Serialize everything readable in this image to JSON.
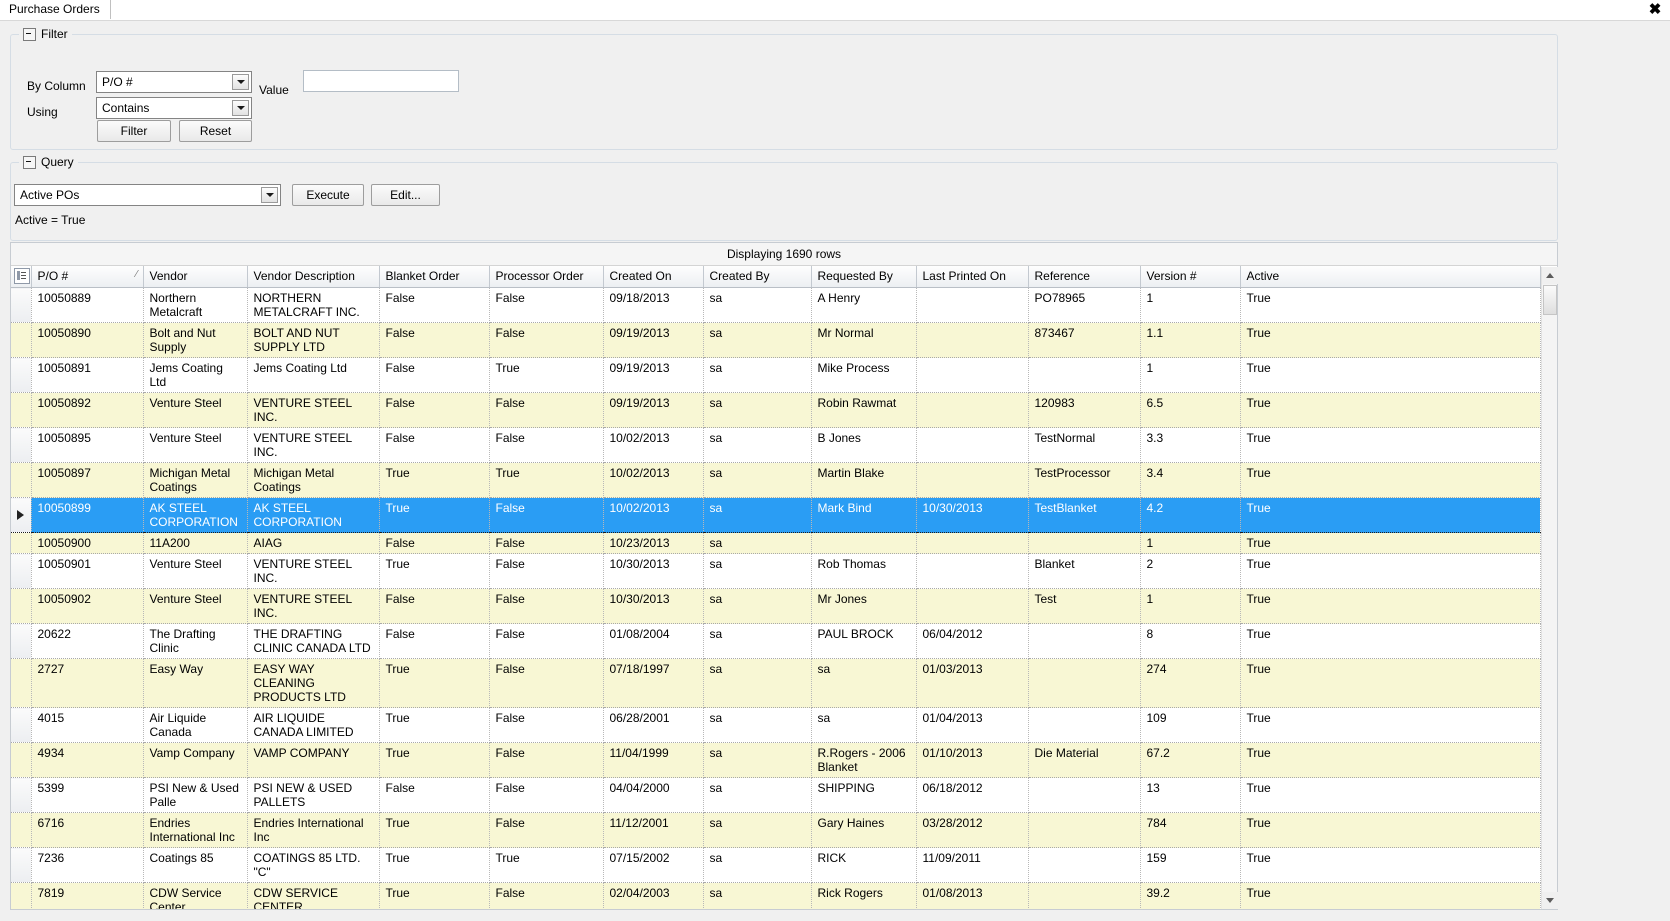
{
  "window": {
    "tab_label": "Purchase Orders",
    "close_icon": "close-icon"
  },
  "filter": {
    "caption": "Filter",
    "by_column_label": "By Column",
    "by_column_value": "P/O #",
    "value_label": "Value",
    "value_text": "",
    "value_placeholder": "",
    "using_label": "Using",
    "using_value": "Contains",
    "filter_button": "Filter",
    "reset_button": "Reset"
  },
  "query": {
    "caption": "Query",
    "selected": "Active POs",
    "execute_button": "Execute",
    "edit_button": "Edit...",
    "description": "Active = True"
  },
  "grid": {
    "status": "Displaying 1690 rows",
    "sort_indicator": "⁄",
    "columns": [
      "P/O #",
      "Vendor",
      "Vendor Description",
      "Blanket Order",
      "Processor Order",
      "Created On",
      "Created By",
      "Requested By",
      "Last Printed On",
      "Reference",
      "Version #",
      "Active"
    ],
    "rows": [
      {
        "cells": [
          "10050889",
          "Northern Metalcraft",
          "NORTHERN METALCRAFT INC.",
          "False",
          "False",
          "09/18/2013",
          "sa",
          "A Henry",
          "",
          "PO78965",
          "1",
          "True"
        ],
        "selected": false
      },
      {
        "cells": [
          "10050890",
          "Bolt and Nut Supply",
          "BOLT AND NUT SUPPLY LTD",
          "False",
          "False",
          "09/19/2013",
          "sa",
          "Mr Normal",
          "",
          "873467",
          "1.1",
          "True"
        ],
        "selected": false
      },
      {
        "cells": [
          "10050891",
          "Jems Coating Ltd",
          "Jems Coating Ltd",
          "False",
          "True",
          "09/19/2013",
          "sa",
          "Mike Process",
          "",
          "",
          "1",
          "True"
        ],
        "selected": false
      },
      {
        "cells": [
          "10050892",
          "Venture Steel",
          "VENTURE STEEL INC.",
          "False",
          "False",
          "09/19/2013",
          "sa",
          "Robin Rawmat",
          "",
          "120983",
          "6.5",
          "True"
        ],
        "selected": false
      },
      {
        "cells": [
          "10050895",
          "Venture Steel",
          "VENTURE STEEL INC.",
          "False",
          "False",
          "10/02/2013",
          "sa",
          "B Jones",
          "",
          "TestNormal",
          "3.3",
          "True"
        ],
        "selected": false
      },
      {
        "cells": [
          "10050897",
          "Michigan Metal Coatings",
          "Michigan Metal Coatings",
          "True",
          "True",
          "10/02/2013",
          "sa",
          "Martin Blake",
          "",
          "TestProcessor",
          "3.4",
          "True"
        ],
        "selected": false
      },
      {
        "cells": [
          "10050899",
          "AK STEEL CORPORATION",
          "AK STEEL CORPORATION",
          "True",
          "False",
          "10/02/2013",
          "sa",
          "Mark Bind",
          "10/30/2013",
          "TestBlanket",
          "4.2",
          "True"
        ],
        "selected": true
      },
      {
        "cells": [
          "10050900",
          "11A200",
          "AIAG",
          "False",
          "False",
          "10/23/2013",
          "sa",
          "",
          "",
          "",
          "1",
          "True"
        ],
        "selected": false
      },
      {
        "cells": [
          "10050901",
          "Venture Steel",
          "VENTURE STEEL INC.",
          "True",
          "False",
          "10/30/2013",
          "sa",
          "Rob Thomas",
          "",
          "Blanket",
          "2",
          "True"
        ],
        "selected": false
      },
      {
        "cells": [
          "10050902",
          "Venture Steel",
          "VENTURE STEEL INC.",
          "False",
          "False",
          "10/30/2013",
          "sa",
          "Mr Jones",
          "",
          "Test",
          "1",
          "True"
        ],
        "selected": false
      },
      {
        "cells": [
          "20622",
          "The Drafting Clinic",
          "THE DRAFTING CLINIC CANADA LTD",
          "False",
          "False",
          "01/08/2004",
          "sa",
          "PAUL BROCK",
          "06/04/2012",
          "",
          "8",
          "True"
        ],
        "selected": false
      },
      {
        "cells": [
          "2727",
          "Easy Way",
          "EASY WAY CLEANING PRODUCTS LTD",
          "True",
          "False",
          "07/18/1997",
          "sa",
          "sa",
          "01/03/2013",
          "",
          "274",
          "True"
        ],
        "selected": false
      },
      {
        "cells": [
          "4015",
          "Air Liquide Canada",
          "AIR LIQUIDE CANADA LIMITED",
          "True",
          "False",
          "06/28/2001",
          "sa",
          "sa",
          "01/04/2013",
          "",
          "109",
          "True"
        ],
        "selected": false
      },
      {
        "cells": [
          "4934",
          "Vamp Company",
          "VAMP COMPANY",
          "True",
          "False",
          "11/04/1999",
          "sa",
          "R.Rogers -  2006 Blanket",
          "01/10/2013",
          "Die Material",
          "67.2",
          "True"
        ],
        "selected": false
      },
      {
        "cells": [
          "5399",
          "PSI New & Used Palle",
          "PSI NEW & USED PALLETS",
          "False",
          "False",
          "04/04/2000",
          "sa",
          "SHIPPING",
          "06/18/2012",
          "",
          "13",
          "True"
        ],
        "selected": false
      },
      {
        "cells": [
          "6716",
          "Endries International Inc",
          "Endries International Inc",
          "True",
          "False",
          "11/12/2001",
          "sa",
          "Gary Haines",
          "03/28/2012",
          "",
          "784",
          "True"
        ],
        "selected": false
      },
      {
        "cells": [
          "7236",
          "Coatings 85",
          "COATINGS 85 LTD. \"C\"",
          "True",
          "True",
          "07/15/2002",
          "sa",
          "RICK",
          "11/09/2011",
          "",
          "159",
          "True"
        ],
        "selected": false
      },
      {
        "cells": [
          "7819",
          "CDW Service Center",
          "CDW SERVICE CENTER",
          "True",
          "False",
          "02/04/2003",
          "sa",
          "Rick Rogers",
          "01/08/2013",
          "",
          "39.2",
          "True"
        ],
        "selected": false
      }
    ]
  },
  "colors": {
    "selection": "#2a9df4",
    "alt_row": "#f8f7d4",
    "panel": "#f0f0f0"
  }
}
